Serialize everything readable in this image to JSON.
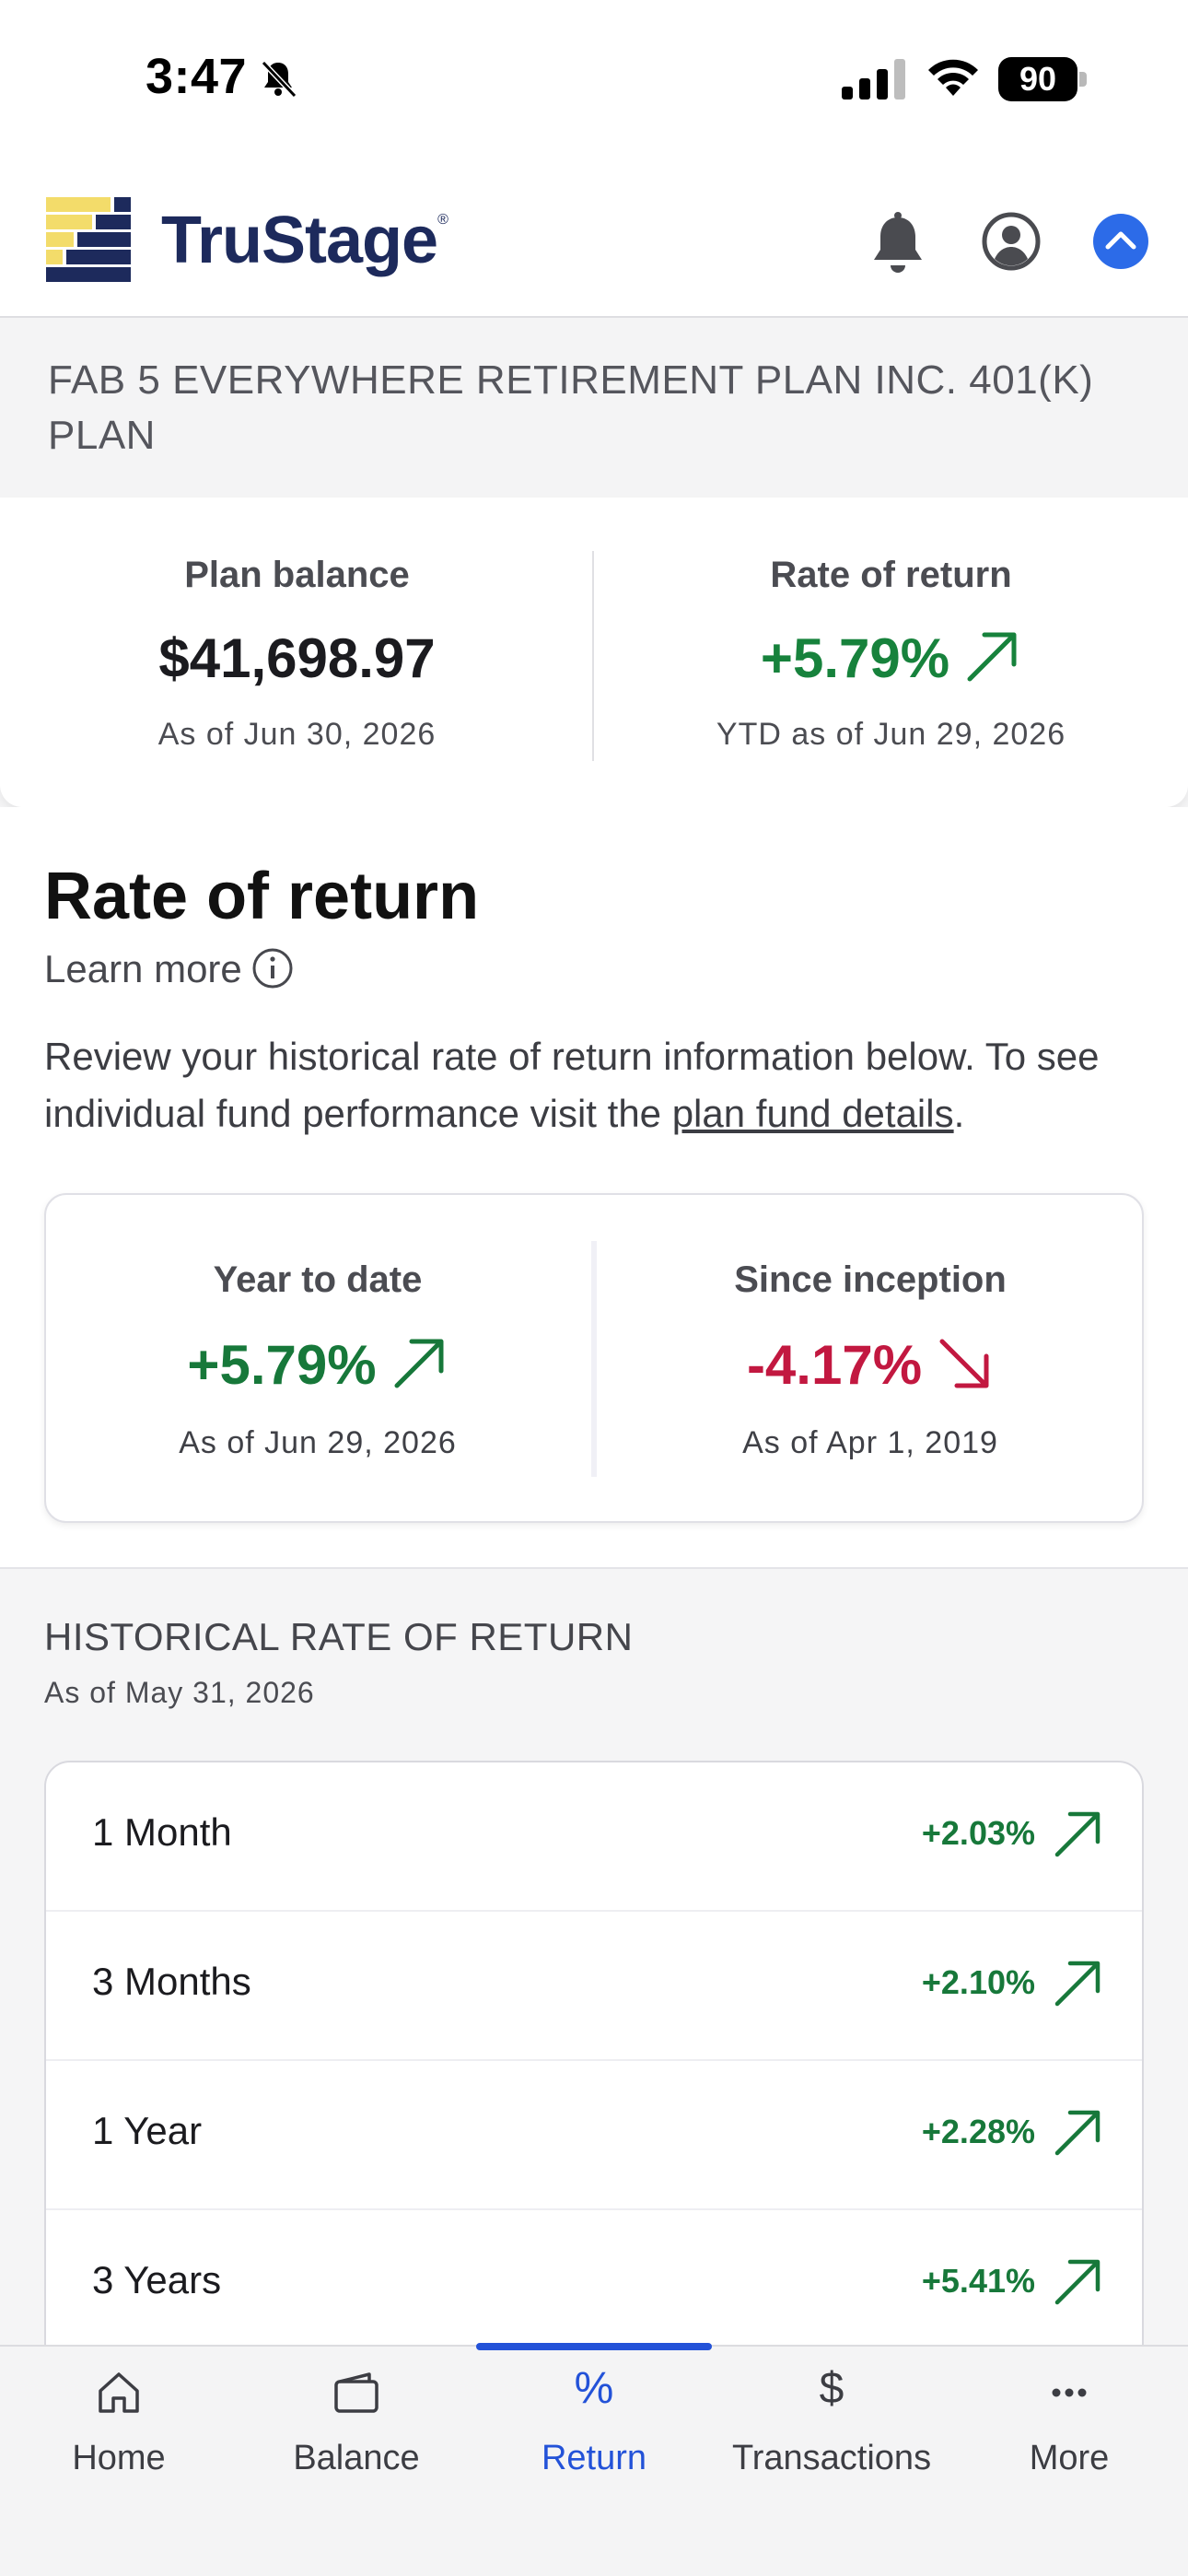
{
  "status_bar": {
    "time": "3:47",
    "battery": "90"
  },
  "header": {
    "brand": "TruStage",
    "brand_mark": "®"
  },
  "plan": {
    "name": "FAB 5 EVERYWHERE RETIREMENT PLAN INC. 401(K) PLAN"
  },
  "summary": {
    "balance_label": "Plan balance",
    "balance_value": "$41,698.97",
    "balance_date": "As of Jun 30, 2026",
    "return_label": "Rate of return",
    "return_value": "+5.79%",
    "return_date": "YTD as of Jun 29, 2026"
  },
  "rate_of_return": {
    "title": "Rate of return",
    "learn_more": "Learn more",
    "description_before": "Review your historical rate of return information below. To see individual fund performance visit the ",
    "description_link": "plan fund details",
    "description_after": ".",
    "ytd": {
      "label": "Year to date",
      "value": "+5.79%",
      "date": "As of Jun 29, 2026"
    },
    "inception": {
      "label": "Since inception",
      "value": "-4.17%",
      "date": "As of Apr 1, 2019"
    }
  },
  "historical": {
    "title": "HISTORICAL RATE OF RETURN",
    "date": "As of May 31, 2026",
    "rows": [
      {
        "label": "1 Month",
        "value": "+2.03%"
      },
      {
        "label": "3 Months",
        "value": "+2.10%"
      },
      {
        "label": "1 Year",
        "value": "+2.28%"
      },
      {
        "label": "3 Years",
        "value": "+5.41%"
      }
    ]
  },
  "tabbar": {
    "tabs": [
      {
        "label": "Home",
        "icon": "home-icon"
      },
      {
        "label": "Balance",
        "icon": "wallet-icon"
      },
      {
        "label": "Return",
        "icon": "percent-icon",
        "glyph": "%"
      },
      {
        "label": "Transactions",
        "icon": "dollar-icon",
        "glyph": "$"
      },
      {
        "label": "More",
        "icon": "more-icon"
      }
    ],
    "active": "Return"
  },
  "colors": {
    "positive": "#17823c",
    "negative": "#c21840",
    "accent": "#2352d8",
    "brand_navy": "#1d2a5c",
    "brand_yellow": "#f3dc6a"
  }
}
